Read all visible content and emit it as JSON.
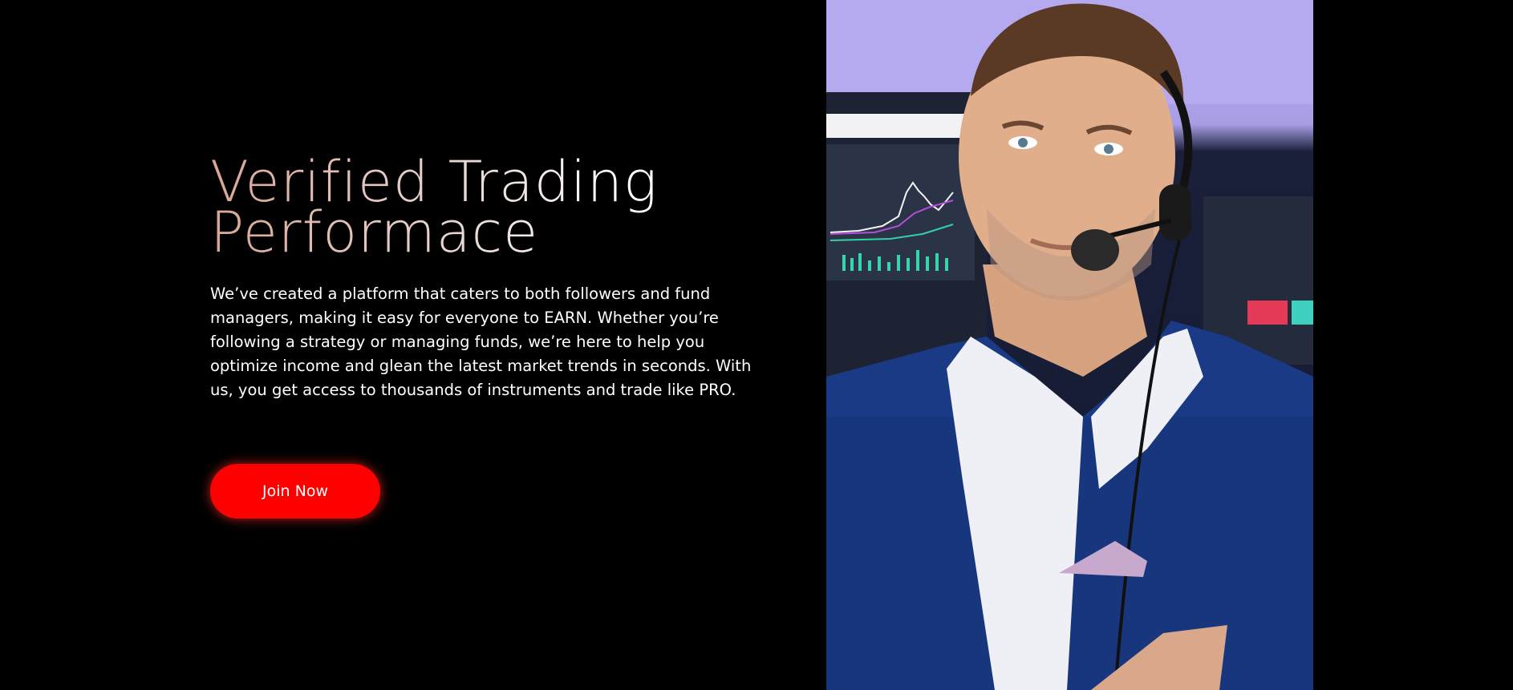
{
  "hero": {
    "title_line1": "Verified Trading",
    "title_line2": "Performace",
    "description": "We’ve created a platform that caters to both followers and fund managers, making it easy for everyone to EARN. Whether you’re following a strategy or managing funds, we’re here to help you optimize income and glean the latest market trends in seconds. With us, you get access to thousands of instruments and trade like PRO.",
    "cta_label": "Join Now"
  },
  "colors": {
    "background": "#000000",
    "accent": "#ff0000",
    "title_gradient_start": "#d9a596",
    "text": "#ffffff"
  },
  "photo": {
    "subject": "trader-with-headset-photo"
  }
}
